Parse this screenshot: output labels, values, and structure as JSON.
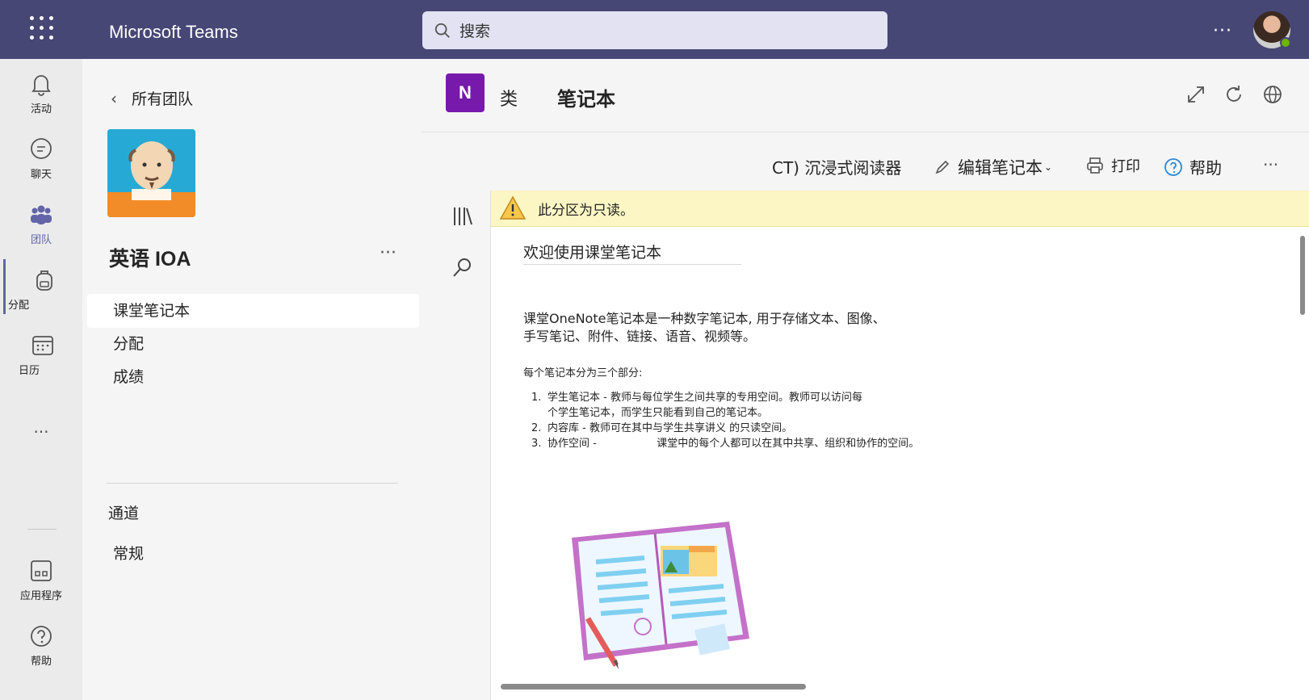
{
  "app": {
    "title": "Microsoft Teams"
  },
  "search": {
    "placeholder": "搜索"
  },
  "topbar": {
    "more_label": "···"
  },
  "rail": {
    "activity": "活动",
    "chat": "聊天",
    "teams": "团队",
    "assignments": "分配",
    "calendar": "日历",
    "more": "···",
    "apps": "应用程序",
    "help": "帮助"
  },
  "team": {
    "back_label": "所有团队",
    "name": "英语 IOA",
    "more_label": "···",
    "nav": [
      "课堂笔记本",
      "分配",
      "成绩"
    ],
    "channels_label": "通道",
    "general_label": "常规"
  },
  "tab": {
    "app_icon_letter": "N",
    "class_label": "类",
    "notebook_label": "笔记本"
  },
  "toolbar": {
    "immersive_reader": "CT) 沉浸式阅读器",
    "edit_notebook": "编辑笔记本",
    "print": "打印",
    "help": "帮助",
    "more": "···"
  },
  "warning": {
    "text": "此分区为只读。"
  },
  "page": {
    "title": "欢迎使用课堂笔记本",
    "intro": "课堂OneNote笔记本是一种数字笔记本, 用于存储文本、图像、手写笔记、附件、链接、语音、视频等。",
    "sub_heading": "每个笔记本分为三个部分:",
    "list": [
      {
        "num": "1.",
        "text": "学生笔记本 - 教师与每位学生之间共享的专用空间。教师可以访问每个学生笔记本，而学生只能看到自己的笔记本。"
      },
      {
        "num": "2.",
        "text": "内容库 - 教师可在其中与学生共享讲义 的只读空间。"
      },
      {
        "num": "3.",
        "text": "协作空间 -                  课堂中的每个人都可以在其中共享、组织和协作的空间。"
      }
    ]
  },
  "colors": {
    "topbar": "#464775",
    "accent": "#6264a7",
    "onenote": "#7719aa",
    "warning_bg": "#fbf6c4"
  }
}
